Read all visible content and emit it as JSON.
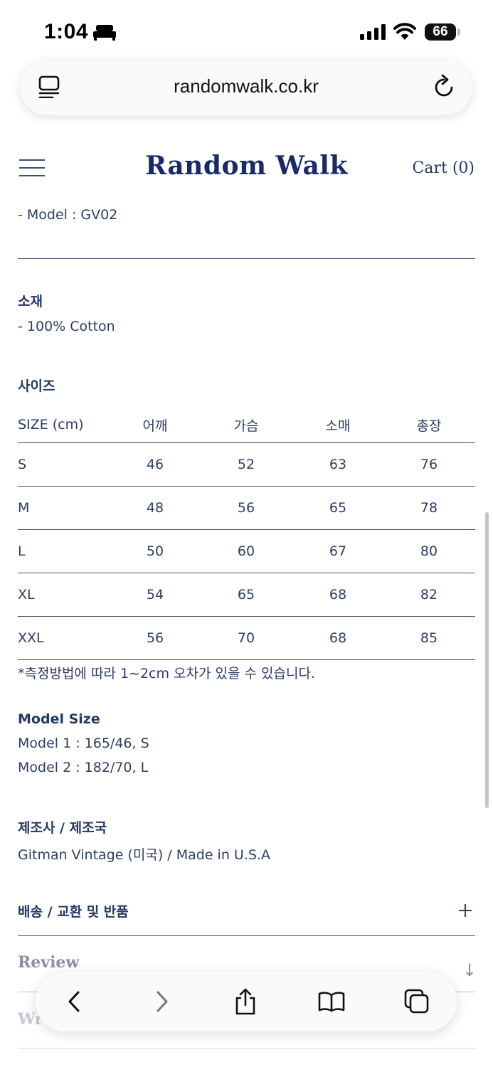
{
  "status_bar": {
    "time": "1:04",
    "battery": "66"
  },
  "browser": {
    "url": "randomwalk.co.kr"
  },
  "header": {
    "brand": "Random Walk",
    "cart": "Cart (0)"
  },
  "product": {
    "model_line": "- Model : GV02",
    "material": {
      "heading": "소재",
      "value": "- 100% Cotton"
    },
    "size_section": {
      "heading": "사이즈",
      "columns": [
        "SIZE (cm)",
        "어깨",
        "가슴",
        "소매",
        "총장"
      ],
      "rows": [
        [
          "S",
          "46",
          "52",
          "63",
          "76"
        ],
        [
          "M",
          "48",
          "56",
          "65",
          "78"
        ],
        [
          "L",
          "50",
          "60",
          "67",
          "80"
        ],
        [
          "XL",
          "54",
          "65",
          "68",
          "82"
        ],
        [
          "XXL",
          "56",
          "70",
          "68",
          "85"
        ]
      ],
      "note": "*측정방법에 따라 1~2cm 오차가 있을 수 있습니다."
    },
    "model_size": {
      "heading": "Model Size",
      "lines": [
        "Model 1 : 165/46, S",
        "Model 2 : 182/70, L"
      ]
    },
    "manufacturer": {
      "heading": "제조사 / 제조국",
      "value": "Gitman Vintage (미국) / Made in U.S.A"
    }
  },
  "accordion": {
    "shipping": "배송 / 교환 및 반품",
    "review": "Review",
    "write": "Wr"
  },
  "icons": [
    "bed-icon",
    "signal-icon",
    "wifi-icon",
    "reader-icon",
    "reload-icon",
    "menu-icon",
    "plus-icon",
    "arrow-down-icon",
    "back-icon",
    "forward-icon",
    "share-icon",
    "bookmarks-icon",
    "tabs-icon"
  ]
}
